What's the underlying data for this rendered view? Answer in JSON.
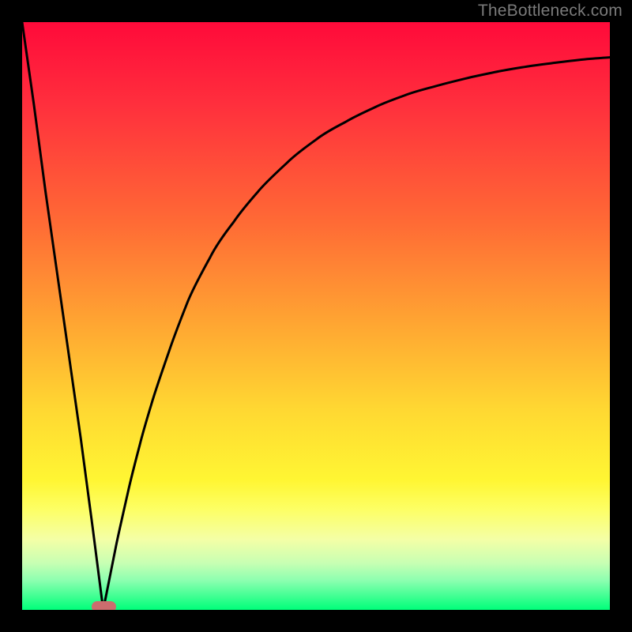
{
  "watermark": "TheBottleneck.com",
  "chart_data": {
    "type": "line",
    "title": "",
    "xlabel": "",
    "ylabel": "",
    "xlim": [
      0,
      100
    ],
    "ylim": [
      0,
      100
    ],
    "grid": false,
    "curve_note": "Values estimated from pixel positions of the black V-shaped curve; y is height above bottom (0–100) against normalized x (0–100).",
    "x": [
      0,
      2,
      4,
      6,
      8,
      10,
      12,
      13.8,
      15,
      16,
      18,
      20,
      22,
      25,
      28,
      32,
      36,
      40,
      45,
      50,
      55,
      60,
      65,
      70,
      75,
      80,
      85,
      90,
      95,
      100
    ],
    "y": [
      100,
      86,
      71,
      57,
      43,
      29,
      14,
      0,
      6,
      11,
      20,
      28,
      35,
      44,
      52,
      60,
      66,
      71,
      76,
      80,
      83,
      85.5,
      87.5,
      89,
      90.3,
      91.4,
      92.3,
      93,
      93.6,
      94
    ],
    "minimum_point": {
      "x_pct": 13.8,
      "y_pct": 0
    },
    "marker": {
      "color": "#cc6d6e",
      "x_pct_range": [
        11.8,
        16.0
      ],
      "y_pct": 0.6
    },
    "background_gradient": {
      "stops": [
        {
          "pct": 0,
          "color": "#ff0a3a"
        },
        {
          "pct": 14,
          "color": "#ff2f3d"
        },
        {
          "pct": 34,
          "color": "#ff6a35"
        },
        {
          "pct": 52,
          "color": "#ffa832"
        },
        {
          "pct": 66,
          "color": "#ffd832"
        },
        {
          "pct": 78,
          "color": "#fff633"
        },
        {
          "pct": 83,
          "color": "#fdff66"
        },
        {
          "pct": 88,
          "color": "#f4ffa6"
        },
        {
          "pct": 92,
          "color": "#c8ffb3"
        },
        {
          "pct": 95,
          "color": "#8cffb0"
        },
        {
          "pct": 98,
          "color": "#37ff8f"
        },
        {
          "pct": 100,
          "color": "#00ff7a"
        }
      ]
    }
  }
}
